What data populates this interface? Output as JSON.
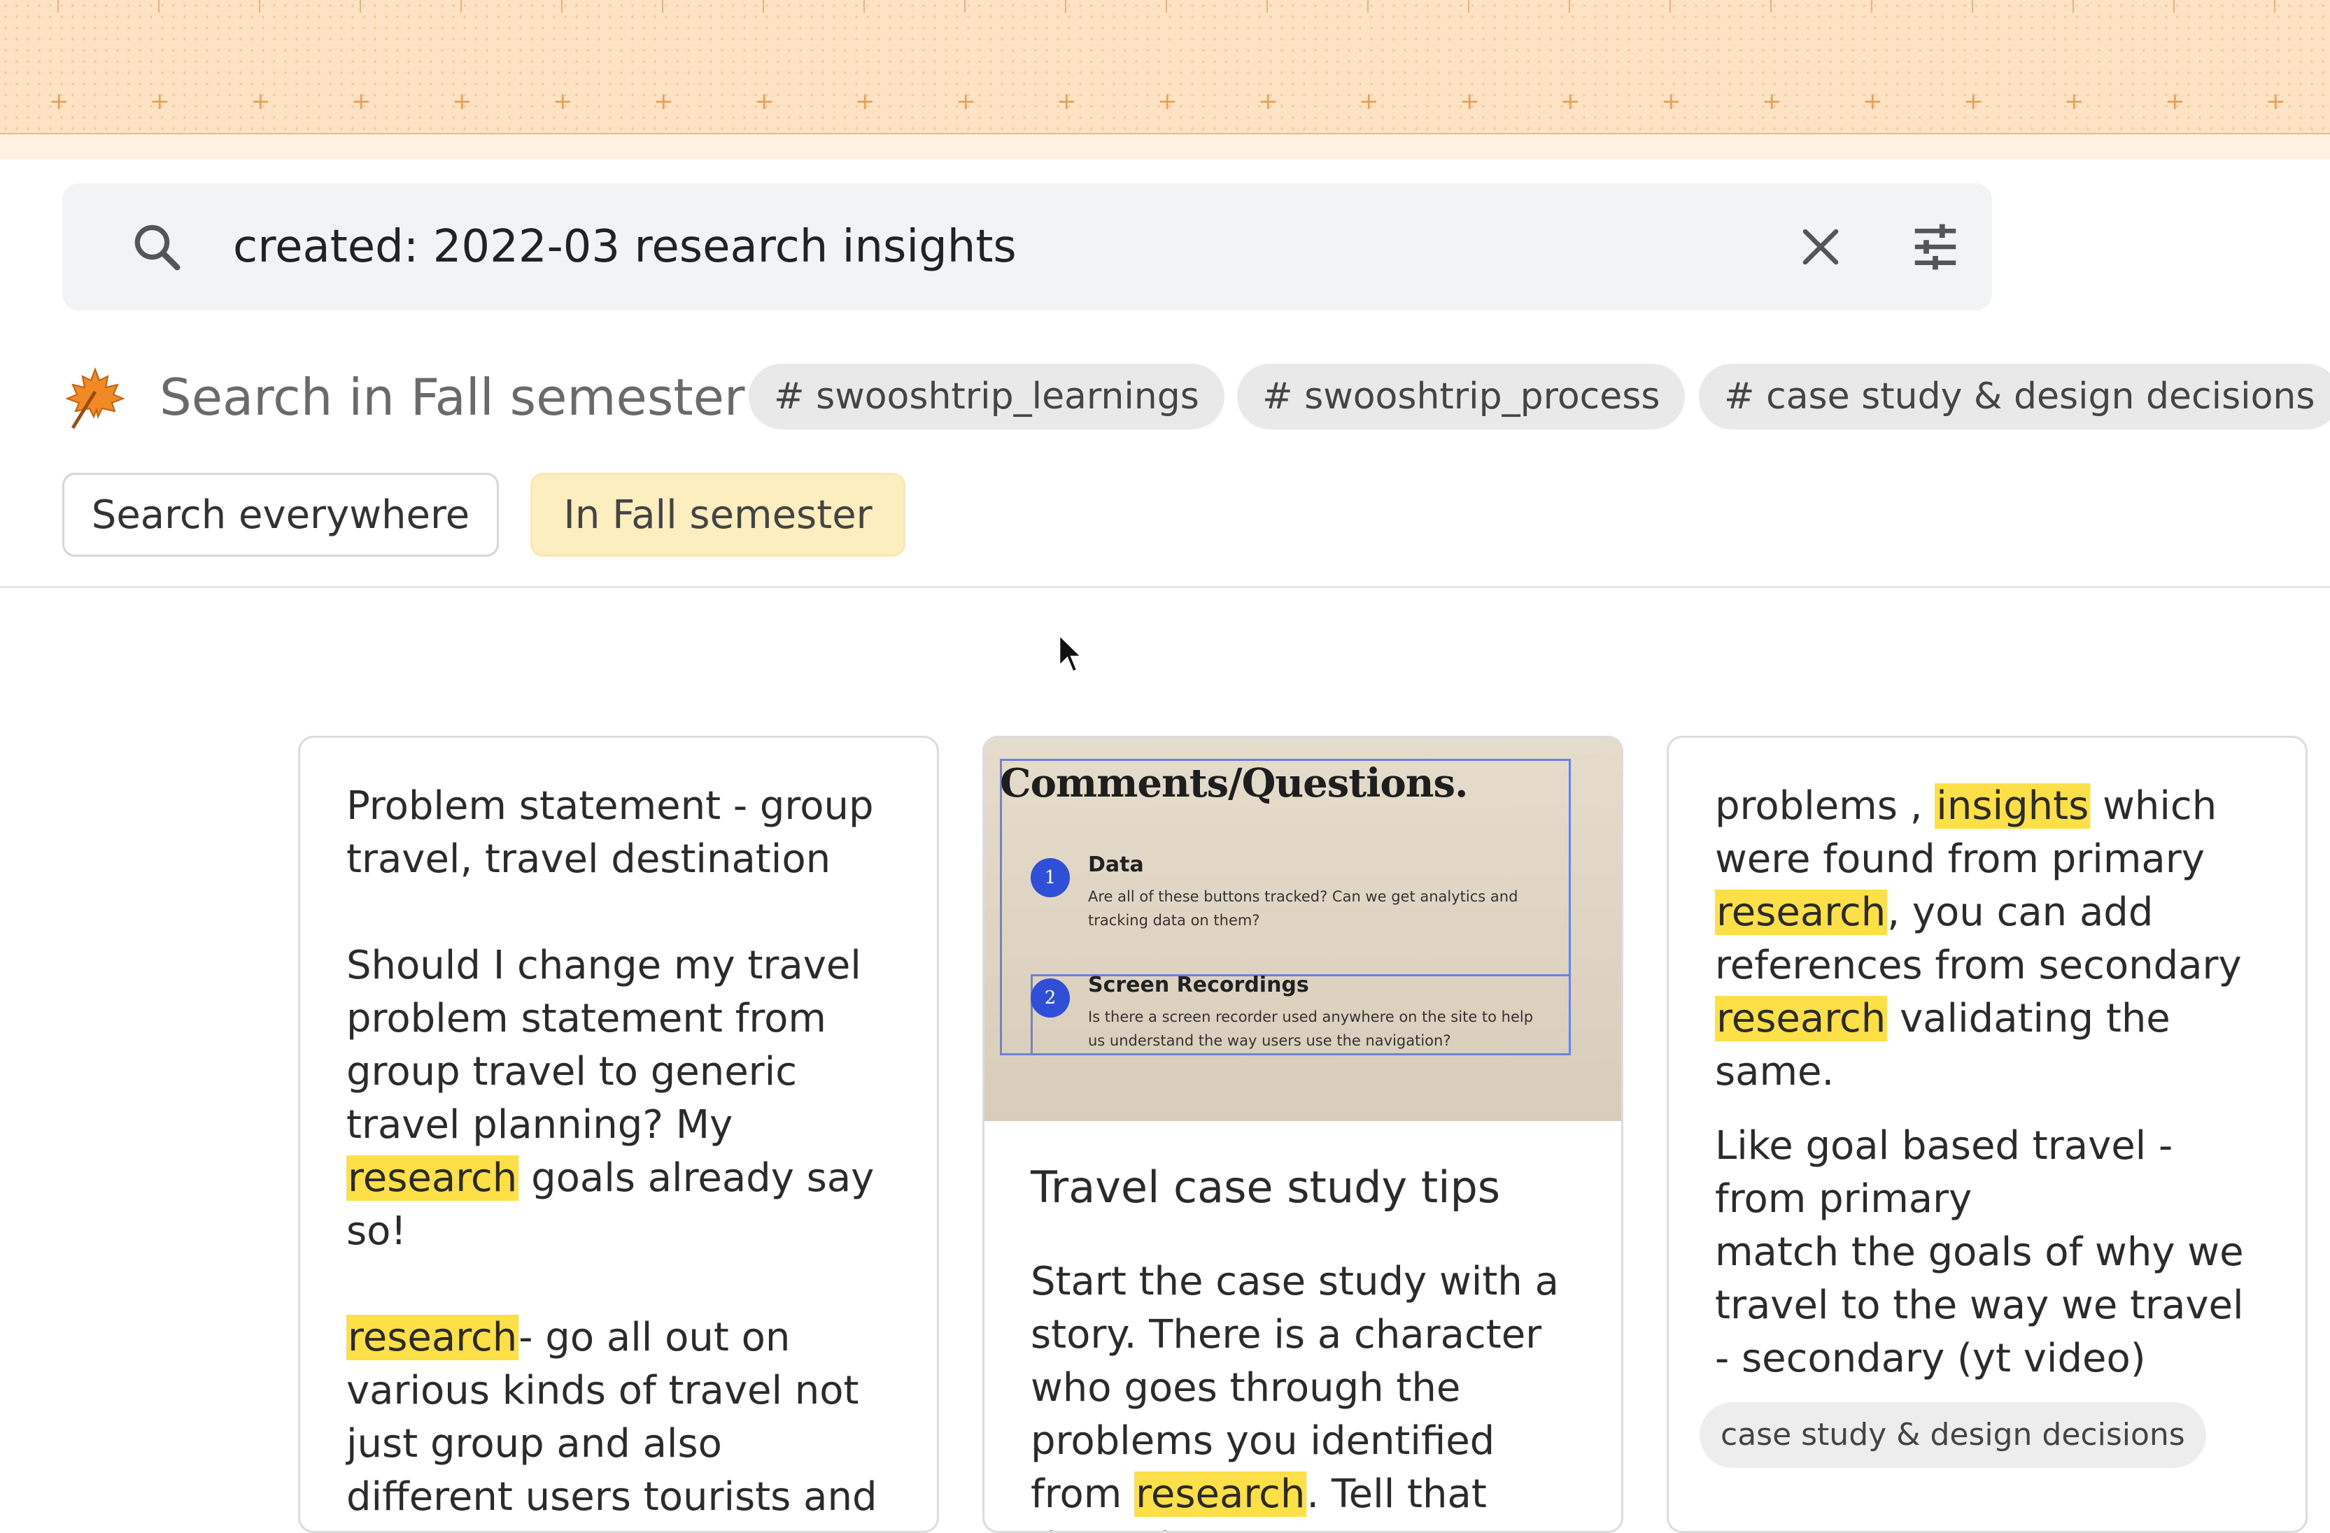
{
  "search": {
    "query": "created: 2022-03 research insights"
  },
  "scope": {
    "title": "Search in Fall semester",
    "tags": [
      "# swooshtrip_learnings",
      "# swooshtrip_process",
      "# case study & design decisions"
    ],
    "buttons": {
      "everywhere": "Search everywhere",
      "fall": "In Fall semester"
    }
  },
  "cards": [
    {
      "p1": "Problem statement - group travel, travel destination",
      "p2_a": "Should I change my travel problem statement from group travel to generic travel planning? My ",
      "p2_hl": "research",
      "p2_b": " goals already say so!",
      "p3_hl": "research",
      "p3_b": "- go all out on various kinds of travel not just group and also different users tourists and niche travellers"
    },
    {
      "slide": {
        "title": "Comments/Questions.",
        "item1_num": "1",
        "item1_heading": "Data",
        "item1_text": "Are all of these buttons tracked? Can we get analytics and tracking data on them?",
        "item2_num": "2",
        "item2_heading": "Screen Recordings",
        "item2_text": "Is there a screen recorder used anywhere on the site to help us understand the way users use the navigation?"
      },
      "title": "Travel case study tips",
      "body_a": "Start the case study with a story. There is a character who goes through the problems you identified from ",
      "body_hl": "research",
      "body_b": ". Tell that through a"
    },
    {
      "p1_a": "problems , ",
      "p1_hl1": "insights",
      "p1_b": " which were found from primary ",
      "p1_hl2": "research",
      "p1_c": ", you can add references from secondary ",
      "p1_hl3": "research",
      "p1_d": " validating the same.",
      "p2_l1": "Like goal based travel - from primary",
      "p2_l2": "match the goals of why we travel to the way we travel - secondary (yt video)",
      "tag": "case study & design decisions"
    }
  ],
  "colors": {
    "highlight": "#fde047",
    "active_scope": "#fdeec0",
    "banner": "#fde3c4"
  }
}
